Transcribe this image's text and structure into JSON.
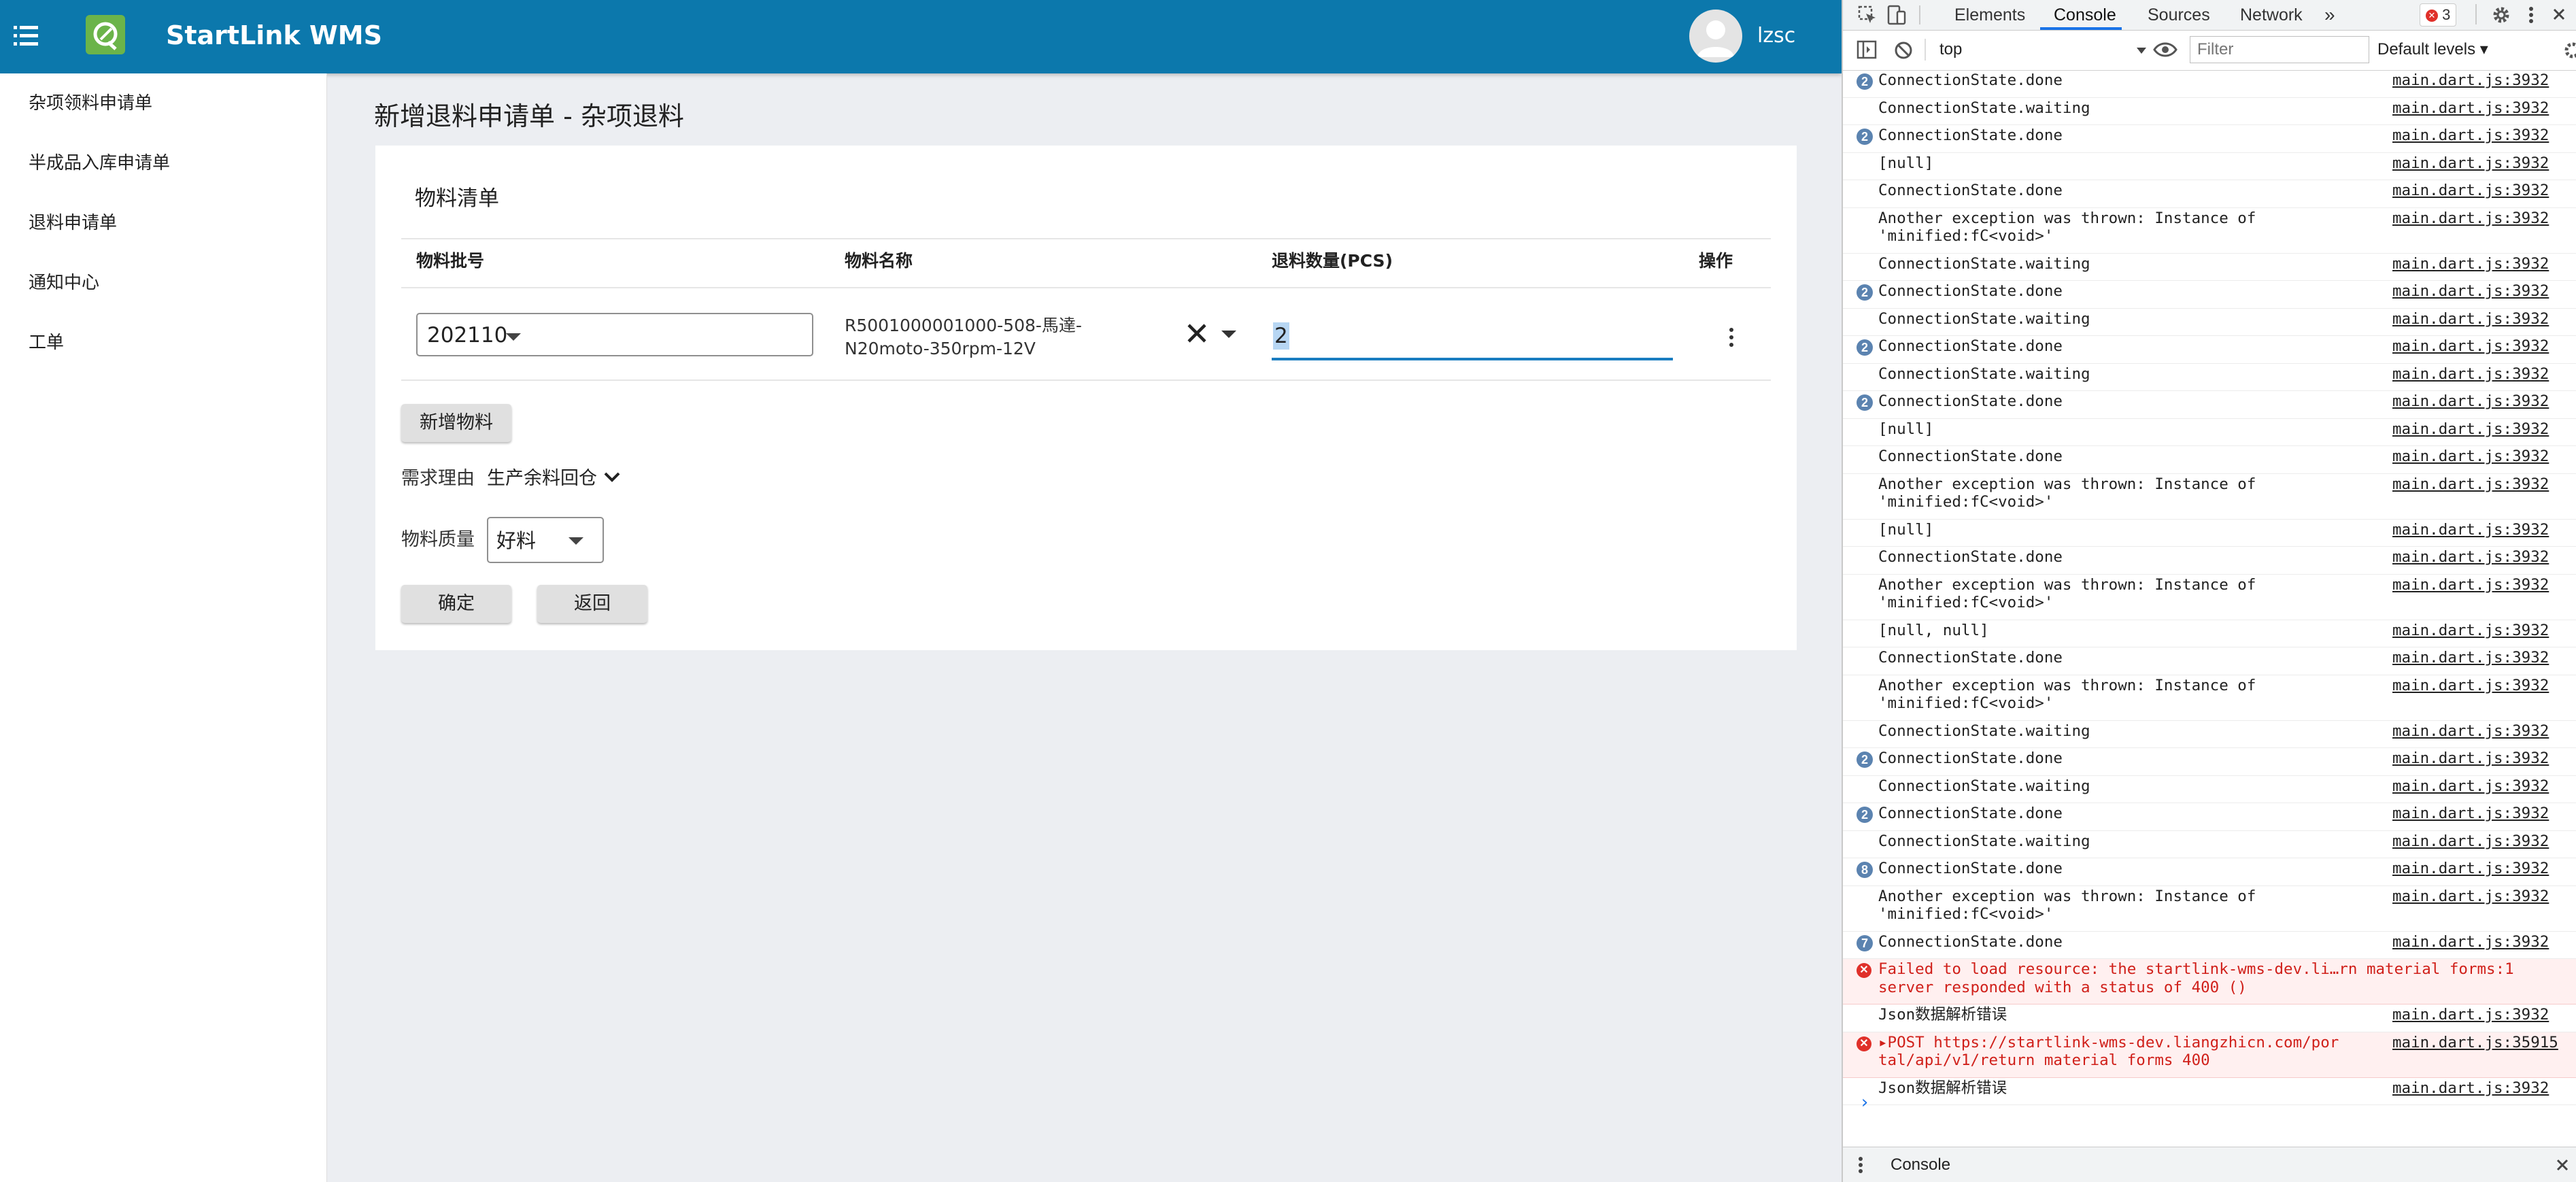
{
  "app": {
    "title": "StartLink WMS",
    "user": "lzsc",
    "header_color": "#0c78ac",
    "logo_color": "#6bb44a"
  },
  "sidebar": {
    "items": [
      {
        "label": "杂项领料申请单"
      },
      {
        "label": "半成品入库申请单"
      },
      {
        "label": "退料申请单"
      },
      {
        "label": "通知中心"
      },
      {
        "label": "工单"
      }
    ]
  },
  "page": {
    "title": "新增退料申请单 - 杂项退料"
  },
  "materials": {
    "title": "物料清单",
    "columns": {
      "batch": "物料批号",
      "name": "物料名称",
      "qty": "退料数量(PCS)",
      "actions": "操作"
    },
    "row": {
      "batch": "202110",
      "name_line1": "R5001000001000-508-馬達-",
      "name_line2": "N20moto-350rpm-12V",
      "qty": "2"
    },
    "add_button": "新增物料"
  },
  "form": {
    "reason_label": "需求理由",
    "reason_value": "生产余料回仓",
    "quality_label": "物料质量",
    "quality_value": "好料",
    "confirm": "确定",
    "back": "返回"
  },
  "devtools": {
    "tabs": {
      "elements": "Elements",
      "console": "Console",
      "sources": "Sources",
      "network": "Network",
      "more": "»"
    },
    "error_count": "3",
    "context": "top",
    "filter_placeholder": "Filter",
    "levels": "Default levels ▾",
    "drawer_tab": "Console",
    "prompt": "›",
    "accent": "#1a73e8",
    "error_color": "#d0201a",
    "logs": [
      {
        "count": "2",
        "text": "ConnectionState.done",
        "src": "main.dart.js:3932"
      },
      {
        "count": "",
        "text": "ConnectionState.waiting",
        "src": "main.dart.js:3932"
      },
      {
        "count": "2",
        "text": "ConnectionState.done",
        "src": "main.dart.js:3932"
      },
      {
        "count": "",
        "text": "[null]",
        "src": "main.dart.js:3932"
      },
      {
        "count": "",
        "text": "ConnectionState.done",
        "src": "main.dart.js:3932"
      },
      {
        "count": "",
        "text": "Another exception was thrown: Instance of\n'minified:fC<void>'",
        "src": "main.dart.js:3932"
      },
      {
        "count": "",
        "text": "ConnectionState.waiting",
        "src": "main.dart.js:3932"
      },
      {
        "count": "2",
        "text": "ConnectionState.done",
        "src": "main.dart.js:3932"
      },
      {
        "count": "",
        "text": "ConnectionState.waiting",
        "src": "main.dart.js:3932"
      },
      {
        "count": "2",
        "text": "ConnectionState.done",
        "src": "main.dart.js:3932"
      },
      {
        "count": "",
        "text": "ConnectionState.waiting",
        "src": "main.dart.js:3932"
      },
      {
        "count": "2",
        "text": "ConnectionState.done",
        "src": "main.dart.js:3932"
      },
      {
        "count": "",
        "text": "[null]",
        "src": "main.dart.js:3932"
      },
      {
        "count": "",
        "text": "ConnectionState.done",
        "src": "main.dart.js:3932"
      },
      {
        "count": "",
        "text": "Another exception was thrown: Instance of\n'minified:fC<void>'",
        "src": "main.dart.js:3932"
      },
      {
        "count": "",
        "text": "[null]",
        "src": "main.dart.js:3932"
      },
      {
        "count": "",
        "text": "ConnectionState.done",
        "src": "main.dart.js:3932"
      },
      {
        "count": "",
        "text": "Another exception was thrown: Instance of\n'minified:fC<void>'",
        "src": "main.dart.js:3932"
      },
      {
        "count": "",
        "text": "[null, null]",
        "src": "main.dart.js:3932"
      },
      {
        "count": "",
        "text": "ConnectionState.done",
        "src": "main.dart.js:3932"
      },
      {
        "count": "",
        "text": "Another exception was thrown: Instance of\n'minified:fC<void>'",
        "src": "main.dart.js:3932"
      },
      {
        "count": "",
        "text": "ConnectionState.waiting",
        "src": "main.dart.js:3932"
      },
      {
        "count": "2",
        "text": "ConnectionState.done",
        "src": "main.dart.js:3932"
      },
      {
        "count": "",
        "text": "ConnectionState.waiting",
        "src": "main.dart.js:3932"
      },
      {
        "count": "2",
        "text": "ConnectionState.done",
        "src": "main.dart.js:3932"
      },
      {
        "count": "",
        "text": "ConnectionState.waiting",
        "src": "main.dart.js:3932"
      },
      {
        "count": "8",
        "text": "ConnectionState.done",
        "src": "main.dart.js:3932"
      },
      {
        "count": "",
        "text": "Another exception was thrown: Instance of\n'minified:fC<void>'",
        "src": "main.dart.js:3932"
      },
      {
        "count": "7",
        "text": "ConnectionState.done",
        "src": "main.dart.js:3932"
      },
      {
        "level": "error",
        "text": "Failed to load resource: the startlink-wms-dev.li…rn material forms:1\nserver responded with a status of 400 ()",
        "src": ""
      },
      {
        "count": "",
        "text": "Json数据解析错误",
        "src": "main.dart.js:3932"
      },
      {
        "level": "error",
        "text": "▸POST https://startlink-wms-dev.liangzhicn.com/por\ntal/api/v1/return material forms 400",
        "src": "main.dart.js:35915"
      },
      {
        "count": "",
        "text": "Json数据解析错误",
        "src": "main.dart.js:3932"
      }
    ]
  }
}
